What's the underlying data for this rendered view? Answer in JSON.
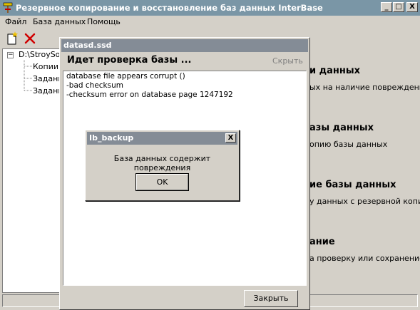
{
  "app": {
    "title": "Резервное копирование и восстановление баз данных InterBase",
    "minimize": "_",
    "maximize": "□",
    "close": "X"
  },
  "menu": [
    "Файл",
    "База данных",
    "Помощь"
  ],
  "toolbar": {
    "new_icon": "new-document-icon",
    "delete_icon": "delete-x-icon"
  },
  "tree": {
    "expander": "−",
    "root": "D:\\StroySof",
    "children": [
      "Копии",
      "Задани",
      "Задани"
    ]
  },
  "right_panel": {
    "sections": [
      {
        "heading": "и данных",
        "desc": "ых на наличие повреждений"
      },
      {
        "heading": "азы данных",
        "desc": "опию базы данных"
      },
      {
        "heading": "ие базы данных",
        "desc": "у данных с резервной копии"
      },
      {
        "heading": "ание",
        "desc": "а проверку или сохранение"
      }
    ]
  },
  "progress_window": {
    "title": "datasd.ssd",
    "heading": "Идет проверка базы ...",
    "hide": "Скрыть",
    "log": [
      "database file appears corrupt ()",
      "-bad checksum",
      "-checksum error on database page 1247192"
    ],
    "close": "Закрыть"
  },
  "dialog": {
    "title": "Ib_backup",
    "close": "X",
    "message": "База данных содержит повреждения",
    "ok": "OK"
  },
  "colors": {
    "titlebar_inactive": "#7a96a6",
    "child_title": "#848c96",
    "face": "#d4d0c8"
  }
}
